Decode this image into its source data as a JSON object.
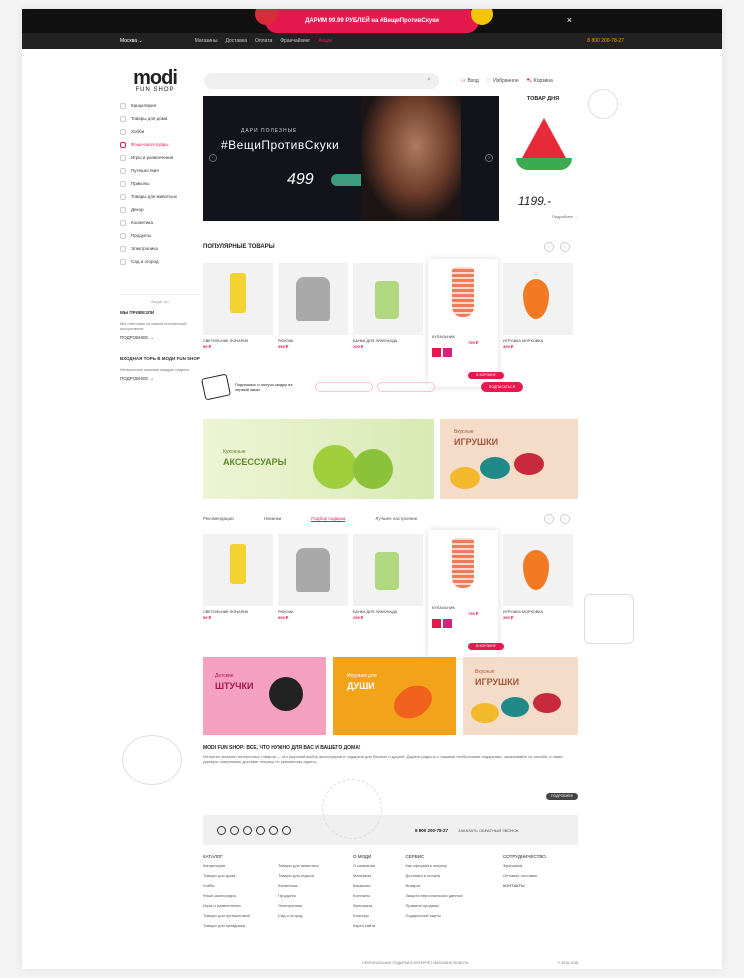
{
  "promo": {
    "text": "ДАРИМ 99.99 РУБЛЕЙ на #ВещиПротивСкуки",
    "close": "×"
  },
  "topbar": {
    "city": "Москва ⌄",
    "nav": [
      "Магазины",
      "Доставка",
      "Оплата",
      "Франчайзинг",
      "Акции"
    ],
    "phone": "8 800 200-78-27"
  },
  "logo": {
    "main": "modi",
    "sub": "FUN SHOP"
  },
  "header": {
    "login": "Вход",
    "favorites": "Избранное",
    "cart": "Корзина"
  },
  "sidebar": {
    "items": [
      "Канцелярия",
      "Товары для дома",
      "Хобби",
      "Фэшн-аксессуары",
      "Игры и развлечения",
      "Путешествия",
      "Приколы",
      "Товары для животных",
      "Декор",
      "Косметика",
      "Продукты",
      "Электроника",
      "Сад и огород"
    ],
    "divider": "Акции тут",
    "block1_title": "МЫ ПРИВЕЗЛИ",
    "block1_text": "Мы отвечаем за самый интересный ассортимент",
    "block1_more": "ПОДРОБНЕЕ →",
    "block2_title": "ВХОДНАЯ ТОРЬ В МОДИ FUN SHOP",
    "block2_text": "Интересные новинки каждую неделю",
    "block2_more": "ПОДРОБНЕЕ →"
  },
  "hero": {
    "line1": "ДАРИ ПОЛЕЗНЫЕ",
    "line2": "#ВещиПротивСкуки",
    "price": "499"
  },
  "day_product": {
    "title": "ТОВАР ДНЯ",
    "price": "1199.-",
    "link": "Подробнее →"
  },
  "popular": {
    "title": "ПОПУЛЯРНЫЕ ТОВАРЫ",
    "products": [
      {
        "name": "СВЕТИЛЬНИК ФОНАРИК",
        "price": "99 ₽"
      },
      {
        "name": "РЮКЗАК",
        "price": "999 ₽"
      },
      {
        "name": "БАНКА ДЛЯ ЛИМОНАДА",
        "price": "299 ₽"
      },
      {
        "name": "КУПАЛЬНИК",
        "price": "799 ₽",
        "old": "999 ₽",
        "button": "В КОРЗИНУ"
      },
      {
        "name": "ИГРУШКА МОРКОВКА",
        "price": "399 ₽"
      }
    ]
  },
  "subscribe": {
    "text": "Подпишись и получи скидку на первый заказ",
    "button": "ПОДПИСАТЬСЯ"
  },
  "banners": [
    {
      "small": "Кухонные",
      "big": "АКСЕССУАРЫ"
    },
    {
      "small": "Вкусные",
      "big": "ИГРУШКИ"
    },
    {
      "small": "Детские",
      "big": "ШТУЧКИ"
    },
    {
      "small": "Игрушки для",
      "big": "ДУШИ"
    },
    {
      "small": "Вкусные",
      "big": "ИГРУШКИ"
    }
  ],
  "tabs": [
    "Рекомендации",
    "Новинки",
    "Подбор подарка",
    "Лучшее настроение"
  ],
  "seo": {
    "title": "MODI FUN SHOP: ВСЕ, ЧТО НУЖНО ДЛЯ ВАС И ВАШЕГО ДОМА!",
    "text": "Интернет-магазин интересных товаров — это широкий выбор аксессуаров и подарков для близких и друзей. Дарите радость с нашими необычными подарками, заказывайте их онлайн, а наши курьеры оперативно доставят покупку по указанному адресу.",
    "more": "ПОДРОБНЕЕ"
  },
  "contact": {
    "phone": "8 800 200-78-27",
    "callback": "ЗАКАЗАТЬ ОБРАТНЫЙ ЗВОНОК"
  },
  "footer": {
    "columns": [
      {
        "title": "КАТАЛОГ",
        "items": [
          "Канцелярия",
          "Товары для дома",
          "Хобби",
          "Фэшн-аксессуары",
          "Игры и развлечения",
          "Товары для путешествий",
          "Товары для праздника"
        ]
      },
      {
        "title": "",
        "items": [
          "Товары для животных",
          "Товары для отдыха",
          "Косметика",
          "Продукты",
          "Электроника",
          "Сад и огород"
        ]
      },
      {
        "title": "О МОДИ",
        "items": [
          "О компании",
          "Магазины",
          "Вакансии",
          "Контакты",
          "Франшиза",
          "Блогеры",
          "Карта сайта"
        ]
      },
      {
        "title": "СЕРВИС",
        "items": [
          "Как оформить покупку",
          "Доставка и оплата",
          "Возврат",
          "Защита персональных данных",
          "Правила продажи",
          "Подарочные карты"
        ]
      },
      {
        "title": "СОТРУДНИЧЕСТВО",
        "items": [
          "Франшиза",
          "Оптовые поставки",
          "КОНТАКТЫ"
        ]
      }
    ],
    "copyright_left": "ОРИГИНАЛЬНЫЕ ПОДАРКИ В ИНТЕРНЕТ-МАГАЗИНЕ MODI.RU",
    "copyright_right": "© 2016-2018"
  },
  "colors": {
    "accent": "#e5194e",
    "dark": "#111111"
  }
}
